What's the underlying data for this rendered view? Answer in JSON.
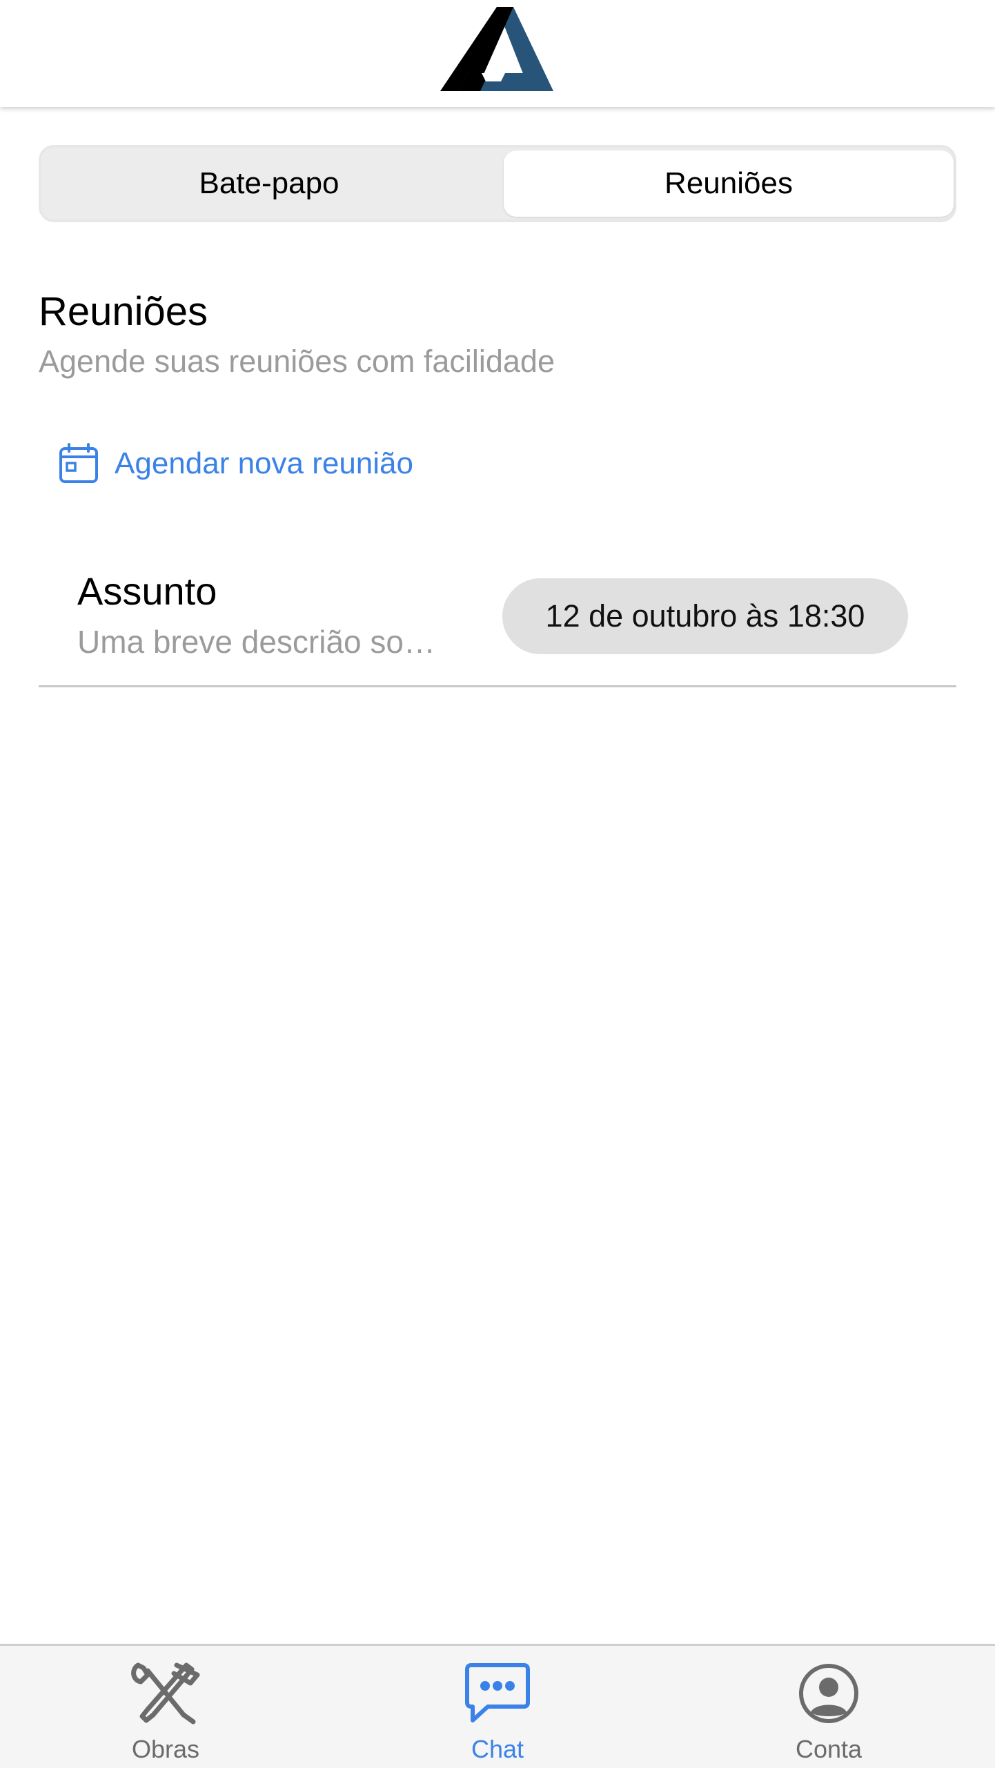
{
  "header": {
    "logo_icon": "brand-a-logo-icon",
    "colors": {
      "logo_dark": "#000000",
      "logo_accent": "#285479"
    }
  },
  "segment": {
    "tabs": [
      {
        "label": "Bate-papo",
        "selected": false
      },
      {
        "label": "Reuniões",
        "selected": true
      }
    ]
  },
  "section": {
    "title": "Reuniões",
    "subtitle": "Agende suas reuniões com facilidade"
  },
  "schedule_action": {
    "icon": "calendar-icon",
    "label": "Agendar nova reunião"
  },
  "meetings": [
    {
      "subject": "Assunto",
      "description": "Uma breve descrião so…",
      "datetime": "12 de outubro às 18:30"
    }
  ],
  "tabbar": {
    "items": [
      {
        "label": "Obras",
        "icon": "tools-icon",
        "active": false
      },
      {
        "label": "Chat",
        "icon": "chat-bubble-icon",
        "active": true
      },
      {
        "label": "Conta",
        "icon": "user-circle-icon",
        "active": false
      }
    ]
  },
  "colors": {
    "accent": "#3b82e8",
    "muted_text": "#9b9b9b",
    "chip_bg": "#e0e0e0",
    "tab_inactive": "#6b6b6b"
  }
}
